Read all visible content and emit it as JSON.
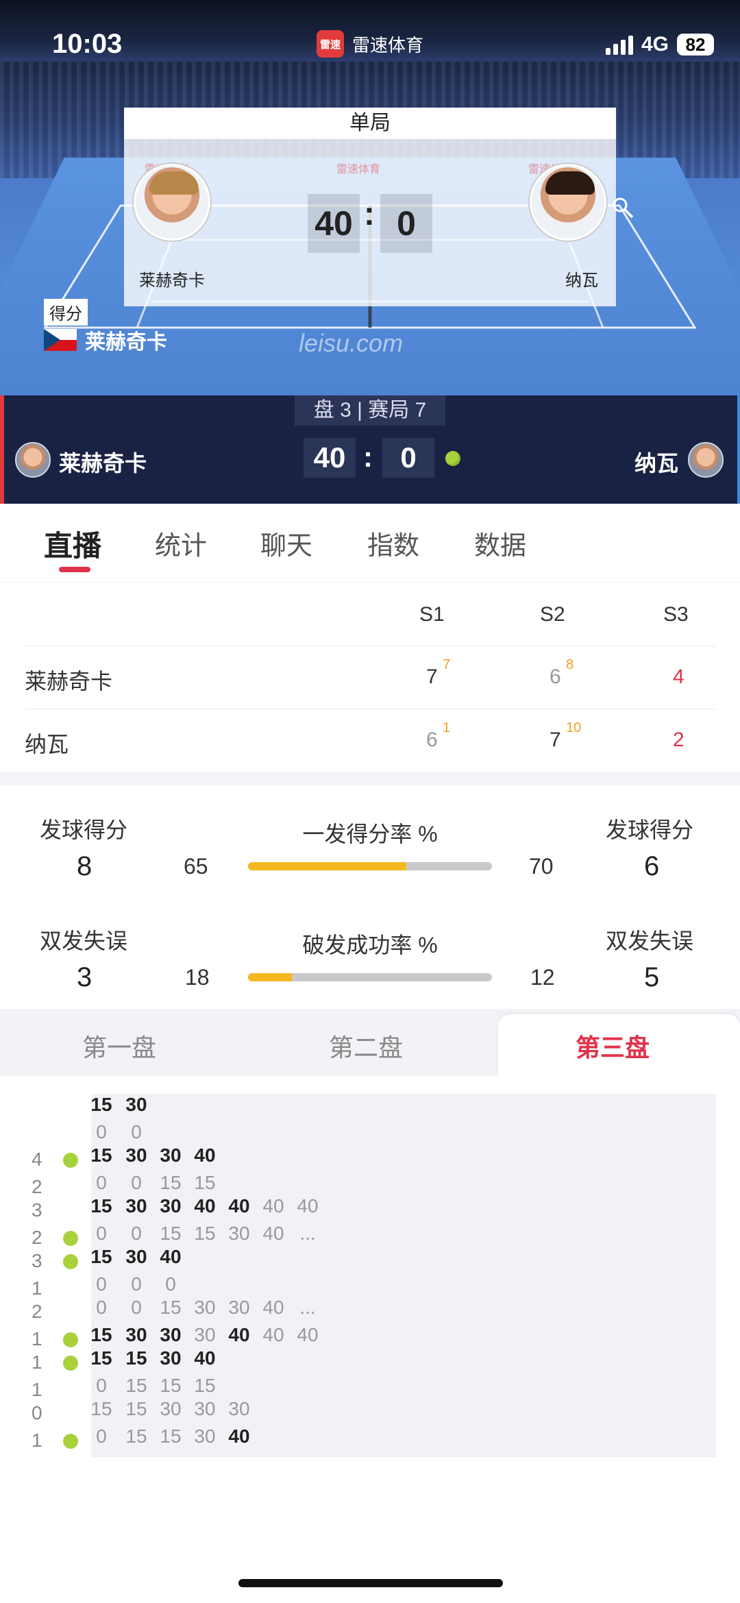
{
  "status_bar": {
    "time": "10:03",
    "app_name": "雷速体育",
    "app_logo_text": "雷速",
    "network": "4G",
    "battery": "82"
  },
  "hero": {
    "card_title": "单局",
    "watermark": "雷速体育",
    "player1": {
      "name": "莱赫奇卡",
      "score": "40"
    },
    "player2": {
      "name": "纳瓦",
      "score": "0"
    },
    "colon": ":",
    "score_tag": "得分",
    "server_name": "莱赫奇卡",
    "site": "leisu.com"
  },
  "scorebar": {
    "label": "盘 3 | 赛局 7",
    "player1": {
      "name": "莱赫奇卡",
      "score": "40"
    },
    "player2": {
      "name": "纳瓦",
      "score": "0"
    },
    "colon": ":"
  },
  "tabs": [
    "直播",
    "统计",
    "聊天",
    "指数",
    "数据"
  ],
  "set_table": {
    "headers": [
      "S1",
      "S2",
      "S3"
    ],
    "rows": [
      {
        "name": "莱赫奇卡",
        "sets": [
          {
            "v": "7",
            "tb": "7"
          },
          {
            "v": "6",
            "tb": "8"
          },
          {
            "v": "4",
            "tb": ""
          }
        ]
      },
      {
        "name": "纳瓦",
        "sets": [
          {
            "v": "6",
            "tb": "1"
          },
          {
            "v": "7",
            "tb": "10"
          },
          {
            "v": "2",
            "tb": ""
          }
        ]
      }
    ]
  },
  "stats": {
    "row1": {
      "left_label": "发球得分",
      "left_value": "8",
      "title": "一发得分率 %",
      "left_pct": 65,
      "right_pct": 70,
      "right_label": "发球得分",
      "right_value": "6"
    },
    "row2": {
      "left_label": "双发失误",
      "left_value": "3",
      "title": "破发成功率 %",
      "left_pct": 18,
      "right_pct": 12,
      "right_label": "双发失误",
      "right_value": "5"
    }
  },
  "set_tabs": [
    "第一盘",
    "第二盘",
    "第三盘"
  ],
  "point_log": [
    {
      "top_score": "",
      "bottom_score": "",
      "server": "",
      "top": [
        "15",
        "30"
      ],
      "bottom": [
        "0",
        "0"
      ]
    },
    {
      "top_score": "4",
      "bottom_score": "2",
      "server": "top",
      "top": [
        "15",
        "30",
        "30",
        "40"
      ],
      "bottom": [
        "0",
        "0",
        "15",
        "15"
      ]
    },
    {
      "top_score": "3",
      "bottom_score": "2",
      "server": "bottom",
      "top": [
        "15",
        "30",
        "30",
        "40",
        "40",
        "40",
        "40"
      ],
      "bottom": [
        "0",
        "0",
        "15",
        "15",
        "30",
        "40",
        "..."
      ]
    },
    {
      "top_score": "3",
      "bottom_score": "1",
      "server": "top",
      "top": [
        "15",
        "30",
        "40"
      ],
      "bottom": [
        "0",
        "0",
        "0"
      ]
    },
    {
      "top_score": "2",
      "bottom_score": "1",
      "server": "bottom",
      "top": [
        "0",
        "0",
        "15",
        "30",
        "30",
        "40",
        "..."
      ],
      "bottom": [
        "15",
        "30",
        "30",
        "30",
        "40",
        "40",
        "40"
      ]
    },
    {
      "top_score": "1",
      "bottom_score": "1",
      "server": "top",
      "top": [
        "15",
        "15",
        "30",
        "40"
      ],
      "bottom": [
        "0",
        "15",
        "15",
        "15"
      ]
    },
    {
      "top_score": "0",
      "bottom_score": "1",
      "server": "bottom",
      "top": [
        "15",
        "15",
        "30",
        "30",
        "30"
      ],
      "bottom": [
        "0",
        "15",
        "15",
        "30",
        "40"
      ]
    }
  ]
}
